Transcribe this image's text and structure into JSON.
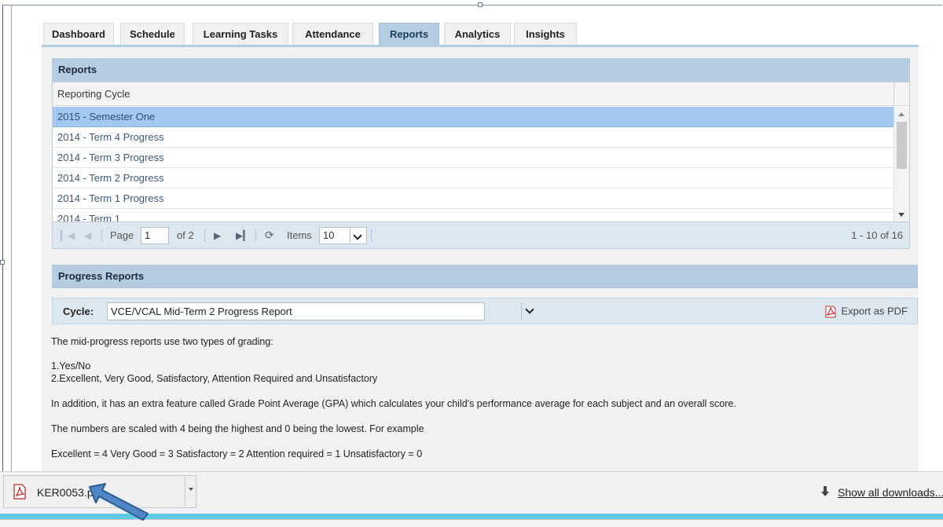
{
  "tabs": [
    {
      "label": "Dashboard",
      "active": false
    },
    {
      "label": "Schedule",
      "active": false
    },
    {
      "label": "Learning Tasks",
      "active": false
    },
    {
      "label": "Attendance",
      "active": false
    },
    {
      "label": "Reports",
      "active": true
    },
    {
      "label": "Analytics",
      "active": false
    },
    {
      "label": "Insights",
      "active": false
    }
  ],
  "reports": {
    "title": "Reports",
    "column": "Reporting Cycle",
    "rows": [
      "2015 - Semester One",
      "2014 - Term 4 Progress",
      "2014 - Term 3 Progress",
      "2014 - Term 2 Progress",
      "2014 - Term 1 Progress",
      "2014 - Term 1"
    ],
    "selected_index": 0,
    "pager": {
      "page_label": "Page",
      "page_value": "1",
      "of_label": "of 2",
      "items_label": "Items",
      "items_value": "10",
      "count": "1 - 10 of 16"
    }
  },
  "progress": {
    "title": "Progress Reports",
    "cycle_label": "Cycle:",
    "cycle_value": "VCE/VCAL Mid-Term 2 Progress Report",
    "export_label": "Export as PDF",
    "paragraphs": [
      "The mid-progress reports use two types of grading:",
      "1.Yes/No",
      "2.Excellent, Very Good, Satisfactory, Attention Required and Unsatisfactory",
      "In addition, it has an extra feature called Grade Point Average (GPA) which calculates your child's performance average for each subject and an overall score.",
      "The numbers are scaled with 4 being the highest and 0 being the lowest. For example",
      "Excellent = 4 Very Good = 3 Satisfactory = 2 Attention required = 1 Unsatisfactory = 0"
    ]
  },
  "downloads": {
    "file_name": "KER0053.p",
    "show_all": "Show all downloads..."
  },
  "colors": {
    "accent": "#b6cde1",
    "selected_row": "#a2c9f0",
    "stripe": "#5fcbe3"
  }
}
